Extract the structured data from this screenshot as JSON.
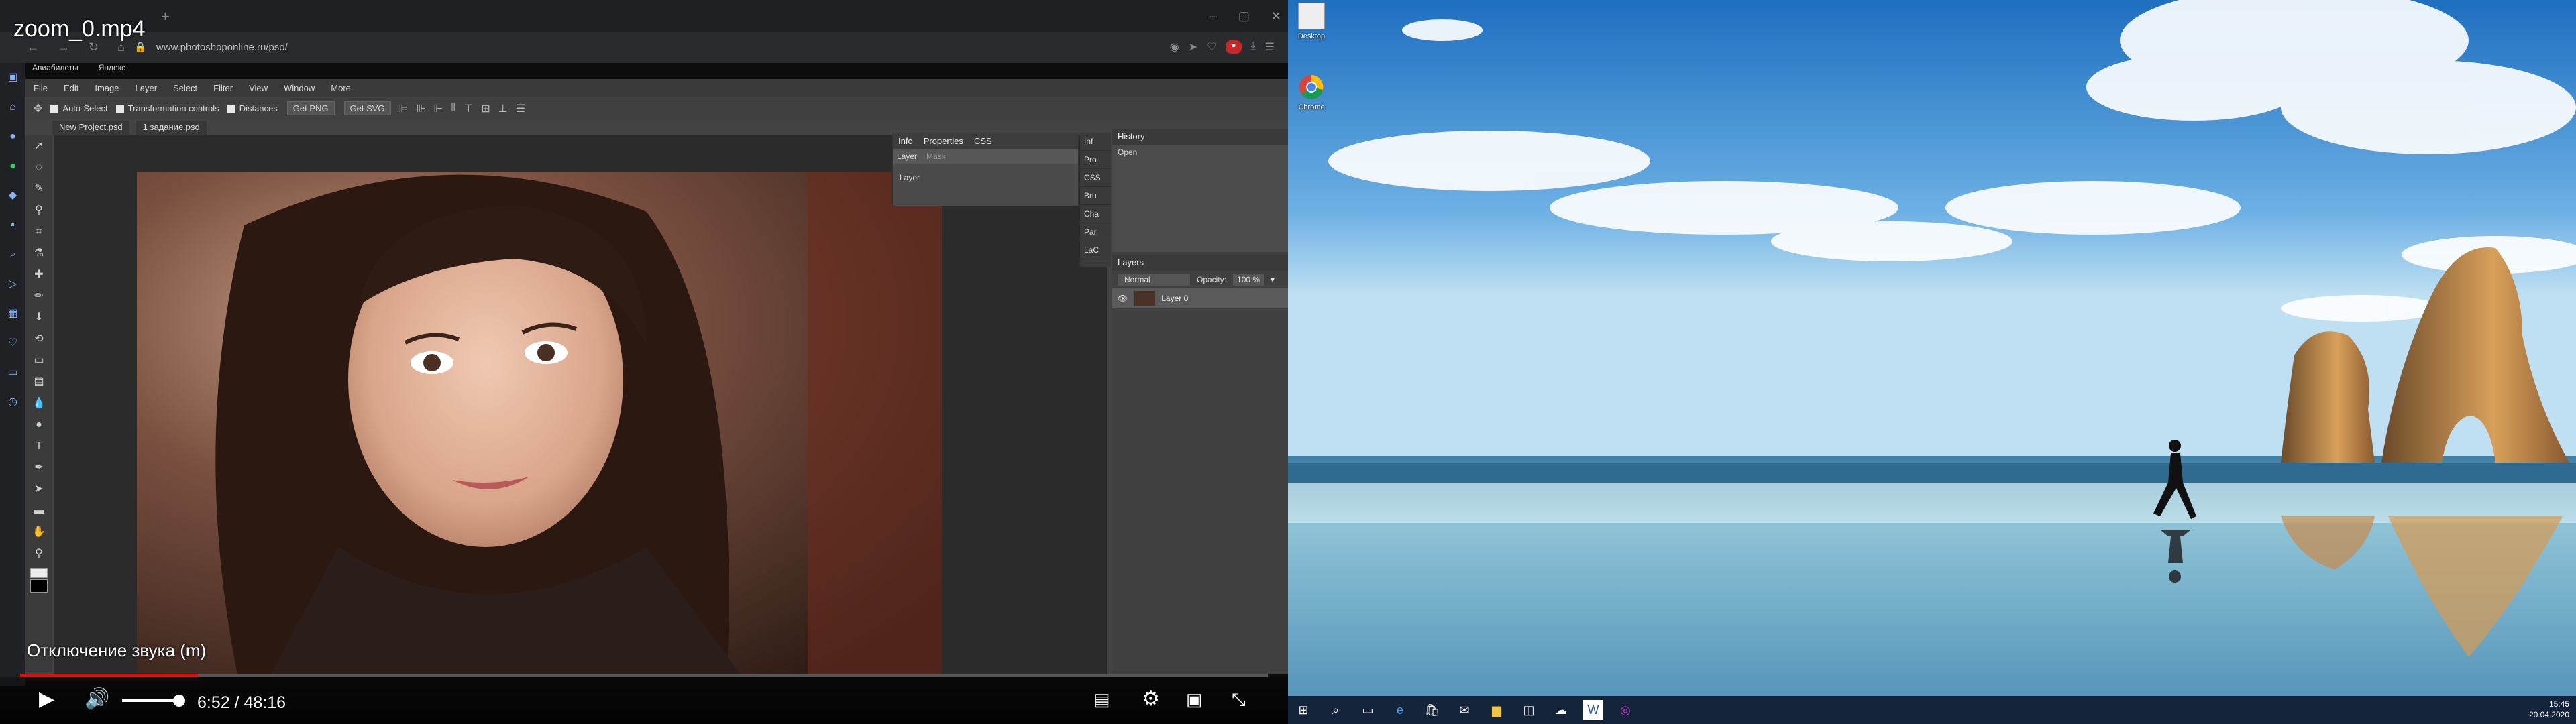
{
  "video": {
    "title": "zoom_0.mp4",
    "mute_tip": "Отключение звука (m)",
    "timecode": "6:52 / 48:16",
    "progress": 0.1424
  },
  "browser": {
    "address": "www.photoshoponline.ru/pso/",
    "bookmarks": [
      "Авиабилеты",
      "Яндекс"
    ]
  },
  "photoshop": {
    "menu": [
      "File",
      "Edit",
      "Image",
      "Layer",
      "Select",
      "Filter",
      "View",
      "Window",
      "More"
    ],
    "options": {
      "auto_select": "Auto-Select",
      "transform": "Transformation controls",
      "distances": "Distances",
      "get_png": "Get PNG",
      "get_svg": "Get SVG"
    },
    "doc_tabs": [
      "New Project.psd",
      "1 задание.psd"
    ],
    "properties_panel": {
      "tabs": [
        "Info",
        "Properties",
        "CSS"
      ],
      "sub_tabs": [
        "Layer",
        "Mask"
      ],
      "row": "Layer"
    },
    "collapsed_panels": [
      "Inf",
      "Pro",
      "CSS",
      "Bru",
      "Cha",
      "Par",
      "LaC"
    ],
    "history": {
      "title": "History",
      "items": [
        "Open"
      ]
    },
    "layers": {
      "title": "Layers",
      "blend_mode": "Normal",
      "opacity_label": "Opacity:",
      "opacity_value": "100 %",
      "layer_name": "Layer 0"
    }
  },
  "desktop": {
    "icons": [
      {
        "label": "Desktop"
      },
      {
        "label": "Chrome"
      }
    ],
    "clock": {
      "time": "15:45",
      "date": "20.04.2020"
    }
  }
}
